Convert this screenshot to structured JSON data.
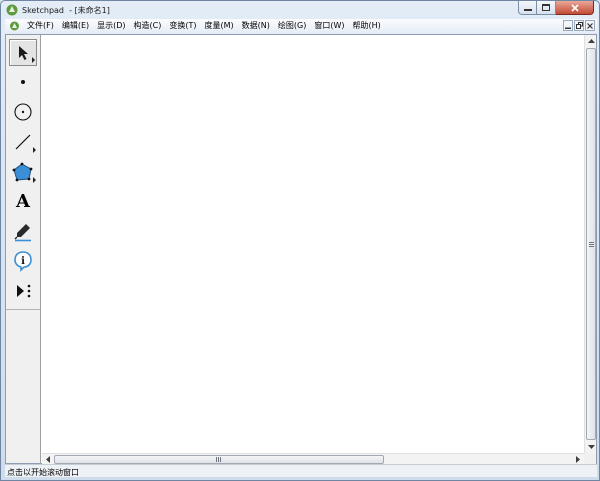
{
  "window": {
    "app_name": "Sketchpad",
    "title": "Sketchpad  - [未命名1]"
  },
  "menu": {
    "items": [
      {
        "label": "文件(F)"
      },
      {
        "label": "编辑(E)"
      },
      {
        "label": "显示(D)"
      },
      {
        "label": "构造(C)"
      },
      {
        "label": "变换(T)"
      },
      {
        "label": "度量(M)"
      },
      {
        "label": "数据(N)"
      },
      {
        "label": "绘图(G)"
      },
      {
        "label": "窗口(W)"
      },
      {
        "label": "帮助(H)"
      }
    ]
  },
  "toolbox": {
    "tools": [
      {
        "name": "arrow-select-tool",
        "icon": "arrow-pointer-icon",
        "selected": true
      },
      {
        "name": "point-tool",
        "icon": "point-icon"
      },
      {
        "name": "compass-tool",
        "icon": "circle-icon"
      },
      {
        "name": "straightedge-tool",
        "icon": "line-segment-icon"
      },
      {
        "name": "polygon-tool",
        "icon": "polygon-icon"
      },
      {
        "name": "text-tool",
        "icon": "text-a-icon",
        "glyph": "A"
      },
      {
        "name": "marker-tool",
        "icon": "marker-pen-icon"
      },
      {
        "name": "information-tool",
        "icon": "info-bubble-icon",
        "glyph": "i"
      },
      {
        "name": "custom-tool",
        "icon": "custom-tool-icon"
      }
    ]
  },
  "status": {
    "text": "点击以开始滚动窗口"
  },
  "colors": {
    "polygon_fill": "#3c8fd6",
    "title_bar": "#dbe6f3",
    "close_button": "#c24a35"
  }
}
